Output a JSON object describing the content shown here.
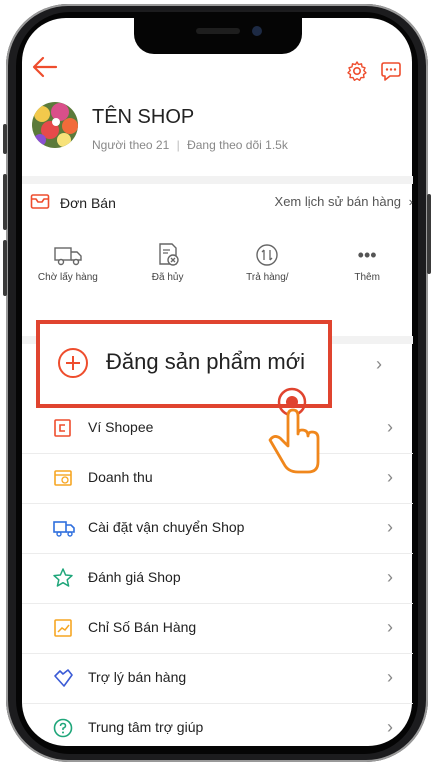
{
  "shop": {
    "name": "TÊN SHOP",
    "followers_label": "Người theo 21",
    "following_label": "Đang theo dõi 1.5k"
  },
  "orders": {
    "title": "Đơn Bán",
    "history_link": "Xem lịch sử bán hàng"
  },
  "order_status": [
    {
      "label": "Chờ lấy hàng",
      "icon": "truck-icon"
    },
    {
      "label": "Đã hủy",
      "icon": "cancelled-doc-icon"
    },
    {
      "label": "Trả hàng/",
      "icon": "return-icon"
    },
    {
      "label": "Thêm",
      "icon": "more-icon"
    }
  ],
  "highlight": {
    "label": "Đăng sản phẩm mới"
  },
  "menu": [
    {
      "label": "Ví Shopee",
      "icon": "wallet-icon",
      "color": "#ee4d2d"
    },
    {
      "label": "Doanh thu",
      "icon": "revenue-icon",
      "color": "#f6a623"
    },
    {
      "label": "Cài đặt vận chuyển Shop",
      "icon": "shipping-icon",
      "color": "#2f6fde"
    },
    {
      "label": "Đánh giá Shop",
      "icon": "star-icon",
      "color": "#1fa67a"
    },
    {
      "label": "Chỉ Số Bán Hàng",
      "icon": "chart-icon",
      "color": "#f6a623"
    },
    {
      "label": "Trợ lý bán hàng",
      "icon": "assistant-icon",
      "color": "#3b5bd6"
    },
    {
      "label": "Trung tâm trợ giúp",
      "icon": "help-icon",
      "color": "#1fa67a"
    }
  ],
  "colors": {
    "accent": "#ee4d2d",
    "highlight_border": "#e0442f"
  }
}
